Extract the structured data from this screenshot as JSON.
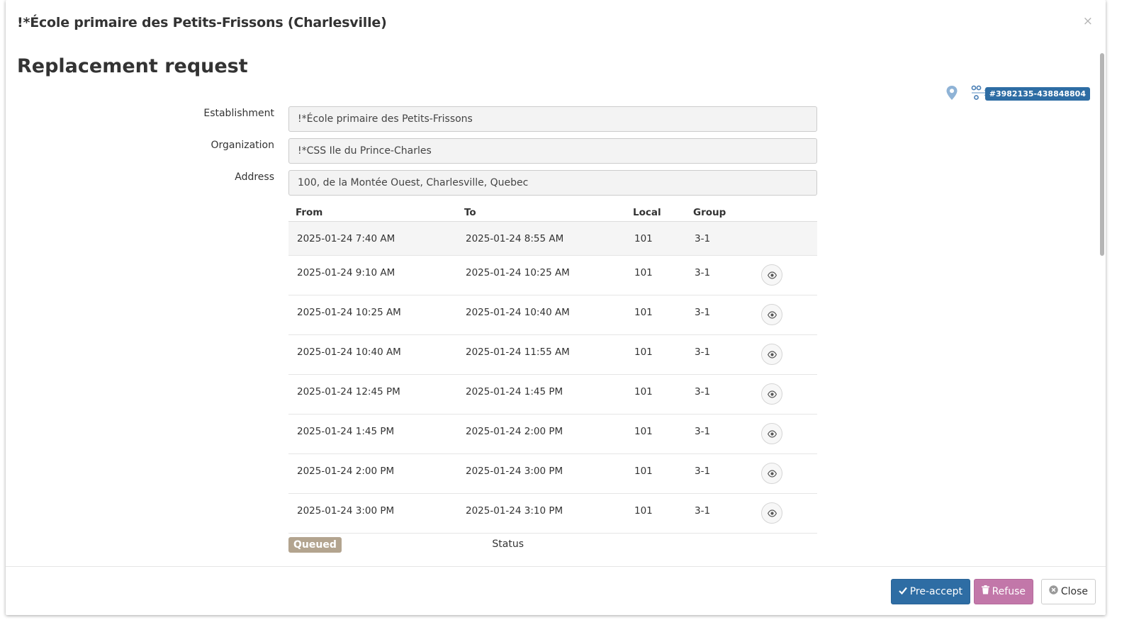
{
  "header": {
    "school_title": "!*École primaire des Petits-Frissons (Charlesville)",
    "close_glyph": "×"
  },
  "page_title": "Replacement request",
  "meta": {
    "icons": [
      "map-pin-icon",
      "route-icon"
    ],
    "reference": "#3982135-438848804"
  },
  "form": {
    "establishment": {
      "label": "Establishment",
      "value": "!*École primaire des Petits-Frissons"
    },
    "organization": {
      "label": "Organization",
      "value": "!*CSS Ile du Prince-Charles"
    },
    "address": {
      "label": "Address",
      "value": "100, de la Montée Ouest, Charlesville, Quebec"
    }
  },
  "schedule": {
    "headers": {
      "from": "From",
      "to": "To",
      "local": "Local",
      "group": "Group"
    },
    "rows": [
      {
        "from": "2025-01-24 7:40 AM",
        "to": "2025-01-24 8:55 AM",
        "local": "101",
        "group": "3-1"
      },
      {
        "from": "2025-01-24 9:10 AM",
        "to": "2025-01-24 10:25 AM",
        "local": "101",
        "group": "3-1"
      },
      {
        "from": "2025-01-24 10:25 AM",
        "to": "2025-01-24 10:40 AM",
        "local": "101",
        "group": "3-1"
      },
      {
        "from": "2025-01-24 10:40 AM",
        "to": "2025-01-24 11:55 AM",
        "local": "101",
        "group": "3-1"
      },
      {
        "from": "2025-01-24 12:45 PM",
        "to": "2025-01-24 1:45 PM",
        "local": "101",
        "group": "3-1"
      },
      {
        "from": "2025-01-24 1:45 PM",
        "to": "2025-01-24 2:00 PM",
        "local": "101",
        "group": "3-1"
      },
      {
        "from": "2025-01-24 2:00 PM",
        "to": "2025-01-24 3:00 PM",
        "local": "101",
        "group": "3-1"
      },
      {
        "from": "2025-01-24 3:00 PM",
        "to": "2025-01-24 3:10 PM",
        "local": "101",
        "group": "3-1"
      }
    ]
  },
  "status": {
    "label": "Status",
    "value": "Queued",
    "color": "#b3a48f"
  },
  "footer": {
    "preaccept_label": "Pre-accept",
    "refuse_label": "Refuse",
    "close_label": "Close"
  },
  "colors": {
    "primary": "#2e6da4",
    "refuse": "#c277a9",
    "badge": "#2e6da4"
  }
}
